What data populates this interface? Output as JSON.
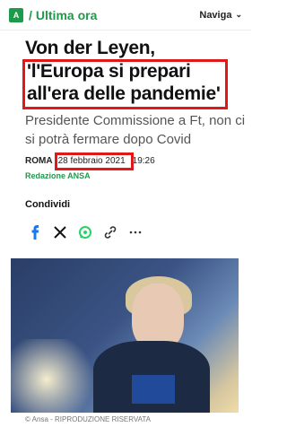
{
  "header": {
    "logo": "A",
    "section": "Ultima ora",
    "nav_label": "Naviga"
  },
  "article": {
    "headline_part1": "Von der Leyen,",
    "headline_quote": "'l'Europa si prepari all'era delle pandemie'",
    "subtitle": "Presidente Commissione a Ft, non ci si potrà fermare dopo Covid",
    "place": "ROMA",
    "date": "28 febbraio 2021",
    "time": "19:26",
    "agency": "Redazione ANSA"
  },
  "share": {
    "label": "Condividi",
    "icons": [
      "facebook-icon",
      "x-icon",
      "whatsapp-icon",
      "link-icon",
      "more-icon"
    ]
  },
  "photo": {
    "caption": "© Ansa - RIPRODUZIONE RISERVATA"
  }
}
